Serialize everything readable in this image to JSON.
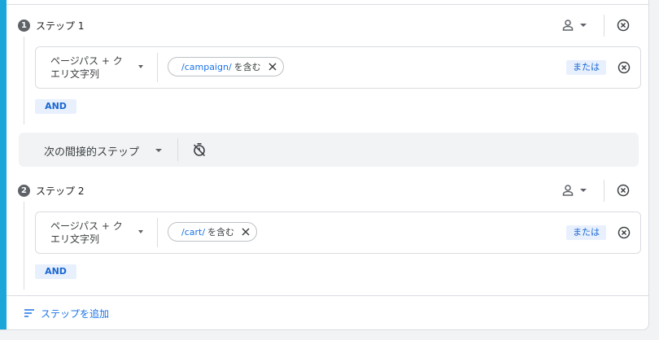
{
  "steps": [
    {
      "number": "1",
      "title": "ステップ 1",
      "condition": {
        "dimension": "ページパス + クエリ文字列",
        "chip_value": "/campaign/",
        "chip_operator": "を含む",
        "or_label": "または"
      },
      "and_label": "AND"
    },
    {
      "number": "2",
      "title": "ステップ 2",
      "condition": {
        "dimension": "ページパス + クエリ文字列",
        "chip_value": "/cart/",
        "chip_operator": "を含む",
        "or_label": "または"
      },
      "and_label": "AND"
    }
  ],
  "connector": {
    "label": "次の間接的ステップ"
  },
  "footer": {
    "add_step_label": "ステップを追加"
  },
  "colors": {
    "accent": "#1aa6d9",
    "link": "#1a73e8",
    "badge_bg": "#e8f0fe"
  },
  "icons": {
    "person": "person-icon",
    "remove": "circle-x-icon",
    "timer": "timer-off-icon",
    "add": "add-step-icon"
  }
}
